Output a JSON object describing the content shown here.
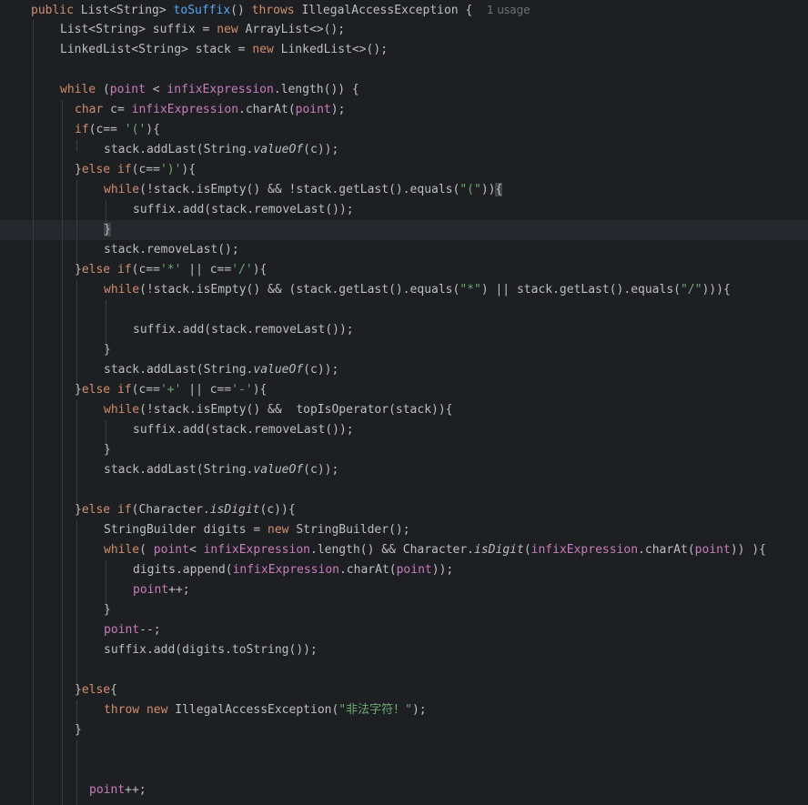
{
  "editor": {
    "lines": [
      {
        "id": "l1",
        "tokens": [
          {
            "t": "public",
            "c": "kw"
          },
          {
            "t": " List<String> "
          },
          {
            "t": "toSuffix",
            "c": "fn"
          },
          {
            "t": "() "
          },
          {
            "t": "throws",
            "c": "kw"
          },
          {
            "t": " IllegalAccessException {  "
          },
          {
            "t": "1 usage",
            "c": "hint"
          }
        ]
      },
      {
        "id": "l2",
        "tokens": [
          {
            "t": "List<String> suffix = "
          },
          {
            "t": "new",
            "c": "kw"
          },
          {
            "t": " ArrayList<>();"
          }
        ]
      },
      {
        "id": "l3",
        "tokens": [
          {
            "t": "LinkedList<String> stack = "
          },
          {
            "t": "new",
            "c": "kw"
          },
          {
            "t": " LinkedList<>();"
          }
        ]
      },
      {
        "id": "l5",
        "tokens": [
          {
            "t": "while",
            "c": "kw"
          },
          {
            "t": " ("
          },
          {
            "t": "point",
            "c": "fld"
          },
          {
            "t": " < "
          },
          {
            "t": "infixExpression",
            "c": "fld"
          },
          {
            "t": ".length()) {"
          }
        ]
      },
      {
        "id": "l6",
        "tokens": [
          {
            "t": "char",
            "c": "kw"
          },
          {
            "t": " c= "
          },
          {
            "t": "infixExpression",
            "c": "fld"
          },
          {
            "t": ".charAt("
          },
          {
            "t": "point",
            "c": "fld"
          },
          {
            "t": ");"
          }
        ]
      },
      {
        "id": "l7",
        "tokens": [
          {
            "t": "if",
            "c": "kw"
          },
          {
            "t": "(c== "
          },
          {
            "t": "'('",
            "c": "str"
          },
          {
            "t": "){"
          }
        ]
      },
      {
        "id": "l8",
        "tokens": [
          {
            "t": "stack.addLast(String."
          },
          {
            "t": "valueOf",
            "c": "it"
          },
          {
            "t": "(c));"
          }
        ]
      },
      {
        "id": "l9",
        "tokens": [
          {
            "t": "}"
          },
          {
            "t": "else",
            "c": "kw"
          },
          {
            "t": " "
          },
          {
            "t": "if",
            "c": "kw"
          },
          {
            "t": "(c=="
          },
          {
            "t": "')'",
            "c": "str"
          },
          {
            "t": "){"
          }
        ]
      },
      {
        "id": "l10",
        "tokens": [
          {
            "t": "while",
            "c": "kw"
          },
          {
            "t": "(!stack.isEmpty() && !stack.getLast().equals("
          },
          {
            "t": "\"(\"",
            "c": "str"
          },
          {
            "t": "))"
          },
          {
            "t": "{",
            "c": "brace-hl"
          }
        ]
      },
      {
        "id": "l11",
        "tokens": [
          {
            "t": "suffix.add(stack.removeLast());"
          }
        ]
      },
      {
        "id": "l12",
        "tokens": [
          {
            "t": "}",
            "c": "brace-hl"
          }
        ]
      },
      {
        "id": "l13",
        "tokens": [
          {
            "t": "stack.removeLast();"
          }
        ]
      },
      {
        "id": "l14",
        "tokens": [
          {
            "t": "}"
          },
          {
            "t": "else",
            "c": "kw"
          },
          {
            "t": " "
          },
          {
            "t": "if",
            "c": "kw"
          },
          {
            "t": "(c=="
          },
          {
            "t": "'*'",
            "c": "str"
          },
          {
            "t": " || c=="
          },
          {
            "t": "'/'",
            "c": "str"
          },
          {
            "t": "){"
          }
        ]
      },
      {
        "id": "l15",
        "tokens": [
          {
            "t": "while",
            "c": "kw"
          },
          {
            "t": "(!stack.isEmpty() && (stack.getLast().equals("
          },
          {
            "t": "\"*\"",
            "c": "str"
          },
          {
            "t": ") || stack.getLast().equals("
          },
          {
            "t": "\"/\"",
            "c": "str"
          },
          {
            "t": "))){"
          }
        ]
      },
      {
        "id": "l17",
        "tokens": [
          {
            "t": "suffix.add(stack.removeLast());"
          }
        ]
      },
      {
        "id": "l18",
        "tokens": [
          {
            "t": "}"
          }
        ]
      },
      {
        "id": "l19",
        "tokens": [
          {
            "t": "stack.addLast(String."
          },
          {
            "t": "valueOf",
            "c": "it"
          },
          {
            "t": "(c));"
          }
        ]
      },
      {
        "id": "l20",
        "tokens": [
          {
            "t": "}"
          },
          {
            "t": "else",
            "c": "kw"
          },
          {
            "t": " "
          },
          {
            "t": "if",
            "c": "kw"
          },
          {
            "t": "(c=="
          },
          {
            "t": "'+'",
            "c": "str"
          },
          {
            "t": " || c=="
          },
          {
            "t": "'-'",
            "c": "str"
          },
          {
            "t": "){"
          }
        ]
      },
      {
        "id": "l21",
        "tokens": [
          {
            "t": "while",
            "c": "kw"
          },
          {
            "t": "(!stack.isEmpty() &&  topIsOperator(stack)){"
          }
        ]
      },
      {
        "id": "l22",
        "tokens": [
          {
            "t": "suffix.add(stack.removeLast());"
          }
        ]
      },
      {
        "id": "l23",
        "tokens": [
          {
            "t": "}"
          }
        ]
      },
      {
        "id": "l24",
        "tokens": [
          {
            "t": "stack.addLast(String."
          },
          {
            "t": "valueOf",
            "c": "it"
          },
          {
            "t": "(c));"
          }
        ]
      },
      {
        "id": "l26",
        "tokens": [
          {
            "t": "}"
          },
          {
            "t": "else",
            "c": "kw"
          },
          {
            "t": " "
          },
          {
            "t": "if",
            "c": "kw"
          },
          {
            "t": "(Character."
          },
          {
            "t": "isDigit",
            "c": "it"
          },
          {
            "t": "(c)){"
          }
        ]
      },
      {
        "id": "l27",
        "tokens": [
          {
            "t": "StringBuilder digits = "
          },
          {
            "t": "new",
            "c": "kw"
          },
          {
            "t": " StringBuilder();"
          }
        ]
      },
      {
        "id": "l28",
        "tokens": [
          {
            "t": "while",
            "c": "kw"
          },
          {
            "t": "( "
          },
          {
            "t": "point",
            "c": "fld"
          },
          {
            "t": "< "
          },
          {
            "t": "infixExpression",
            "c": "fld"
          },
          {
            "t": ".length() && Character."
          },
          {
            "t": "isDigit",
            "c": "it"
          },
          {
            "t": "("
          },
          {
            "t": "infixExpression",
            "c": "fld"
          },
          {
            "t": ".charAt("
          },
          {
            "t": "point",
            "c": "fld"
          },
          {
            "t": ")) ){"
          }
        ]
      },
      {
        "id": "l29",
        "tokens": [
          {
            "t": "digits.append("
          },
          {
            "t": "infixExpression",
            "c": "fld"
          },
          {
            "t": ".charAt("
          },
          {
            "t": "point",
            "c": "fld"
          },
          {
            "t": "));"
          }
        ]
      },
      {
        "id": "l30",
        "tokens": [
          {
            "t": "point",
            "c": "fld"
          },
          {
            "t": "++;"
          }
        ]
      },
      {
        "id": "l31",
        "tokens": [
          {
            "t": "}"
          }
        ]
      },
      {
        "id": "l32",
        "tokens": [
          {
            "t": "point",
            "c": "fld"
          },
          {
            "t": "--;"
          }
        ]
      },
      {
        "id": "l33",
        "tokens": [
          {
            "t": "suffix.add(digits.toString());"
          }
        ]
      },
      {
        "id": "l35",
        "tokens": [
          {
            "t": "}"
          },
          {
            "t": "else",
            "c": "kw"
          },
          {
            "t": "{"
          }
        ]
      },
      {
        "id": "l36",
        "tokens": [
          {
            "t": "throw",
            "c": "kw"
          },
          {
            "t": " "
          },
          {
            "t": "new",
            "c": "kw"
          },
          {
            "t": " IllegalAccessException("
          },
          {
            "t": "\"非法字符！\"",
            "c": "str"
          },
          {
            "t": ");"
          }
        ]
      },
      {
        "id": "l37",
        "tokens": [
          {
            "t": "}"
          }
        ]
      },
      {
        "id": "l40",
        "tokens": [
          {
            "t": "point",
            "c": "fld"
          },
          {
            "t": "++;"
          }
        ]
      }
    ]
  },
  "colors": {
    "background": "#1e1f22",
    "keyword": "#cf8e6d",
    "method": "#56a8f5",
    "field": "#c77dbb",
    "string": "#6aab73",
    "text": "#bcbec4",
    "hint": "#6f737a"
  }
}
